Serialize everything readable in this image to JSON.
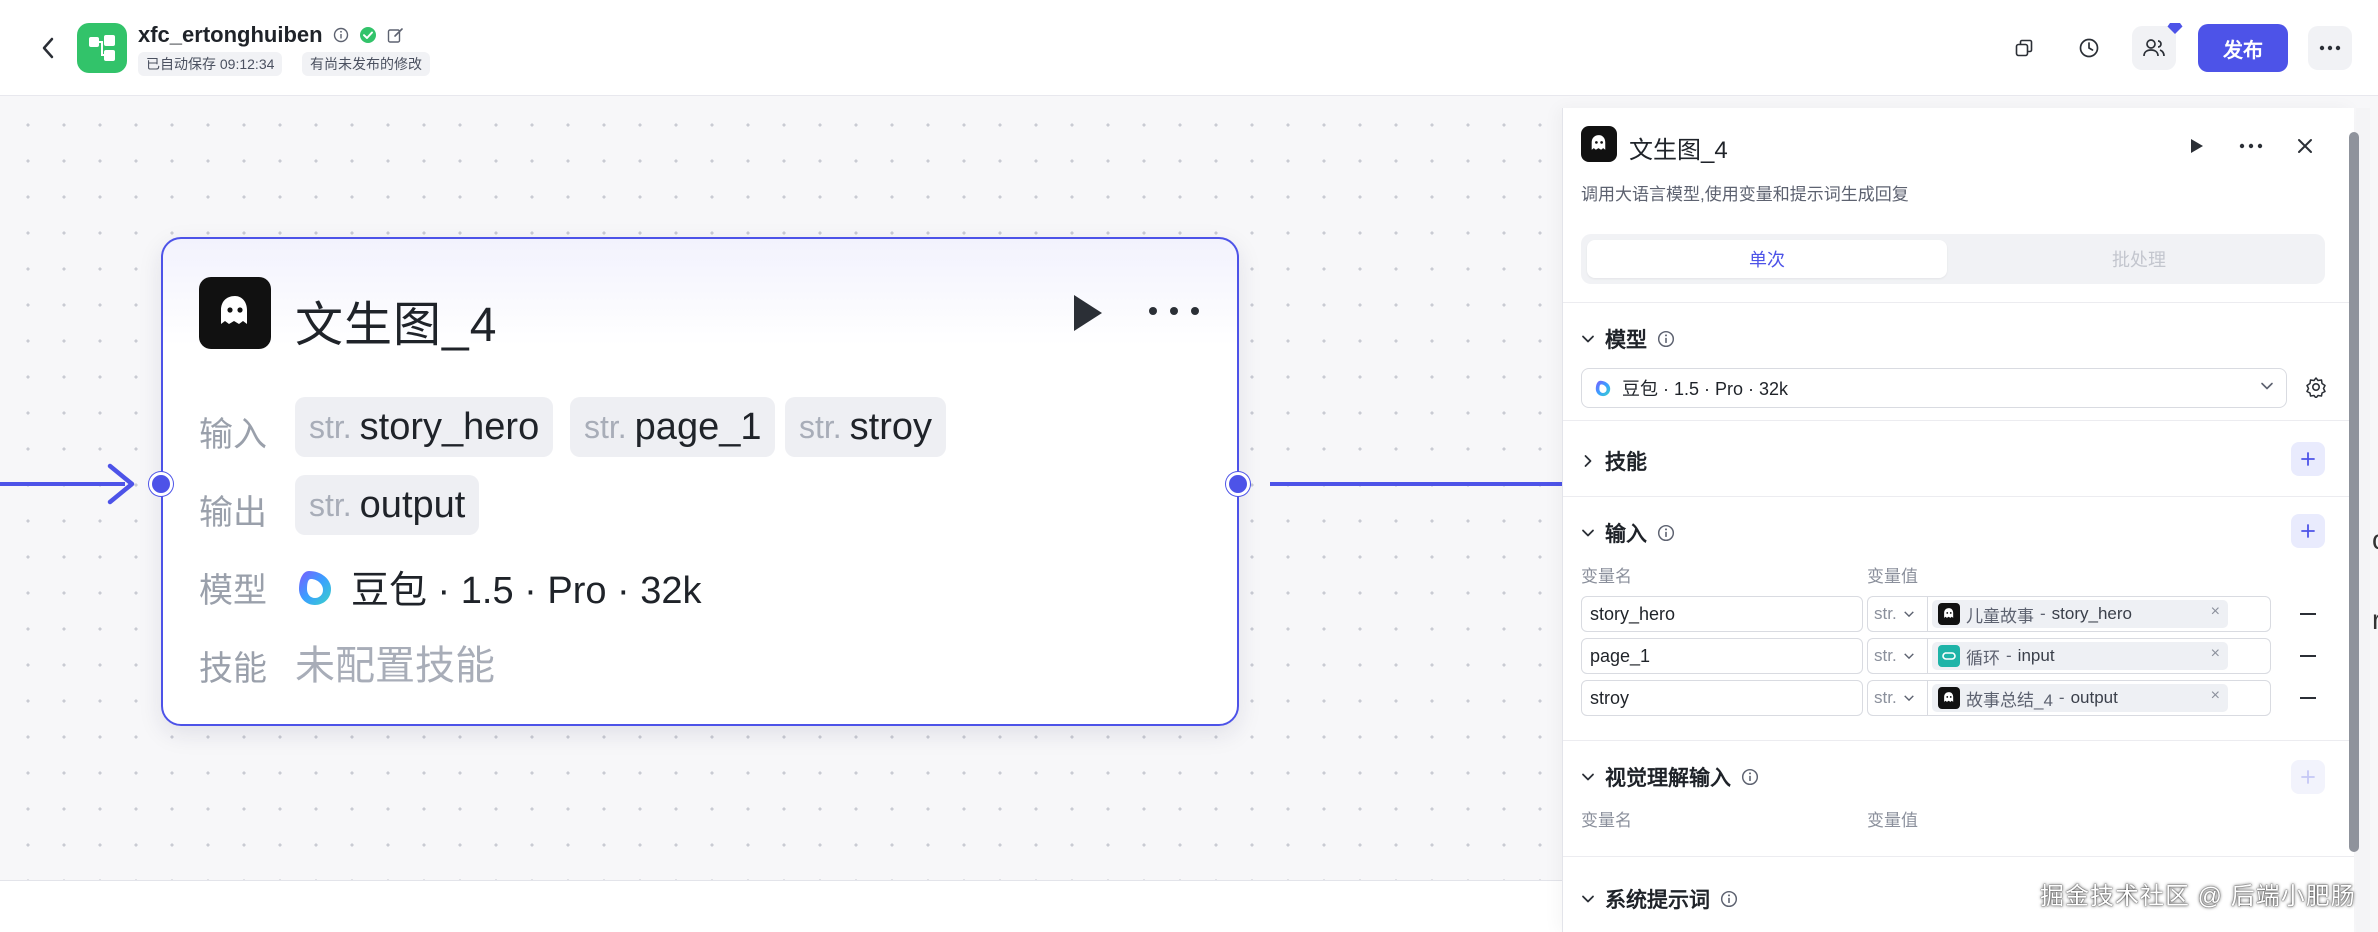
{
  "header": {
    "app_name": "xfc_ertonghuiben",
    "autosave_tag": "已自动保存 09:12:34",
    "unpublished_tag": "有尚未发布的修改",
    "publish_label": "发布"
  },
  "node": {
    "title": "文生图_4",
    "input_label": "输入",
    "output_label": "输出",
    "model_label": "模型",
    "skill_label": "技能",
    "inputs": [
      {
        "type": "str.",
        "name": "story_hero"
      },
      {
        "type": "str.",
        "name": "page_1"
      },
      {
        "type": "str.",
        "name": "stroy"
      }
    ],
    "output": {
      "type": "str.",
      "name": "output"
    },
    "model_value": "豆包 · 1.5 · Pro · 32k",
    "skill_value": "未配置技能"
  },
  "panel": {
    "title": "文生图_4",
    "description": "调用大语言模型,使用变量和提示词生成回复",
    "tabs": [
      {
        "label": "单次",
        "active": true
      },
      {
        "label": "批处理",
        "active": false
      }
    ],
    "model_section": "模型",
    "model_select": "豆包 · 1.5 · Pro · 32k",
    "skill_section": "技能",
    "input_section": "输入",
    "var_name_header": "变量名",
    "var_value_header": "变量值",
    "inputs": [
      {
        "name": "story_hero",
        "type": "str.",
        "source": "儿童故事",
        "sep": " - ",
        "ref": "story_hero",
        "icon": "ghost-icon"
      },
      {
        "name": "page_1",
        "type": "str.",
        "source": "循环",
        "sep": " - ",
        "ref": "input",
        "icon": "loop-icon"
      },
      {
        "name": "stroy",
        "type": "str.",
        "source": "故事总结_4",
        "sep": " - ",
        "ref": "output",
        "icon": "ghost-icon"
      }
    ],
    "vision_section": "视觉理解输入",
    "vision_var_name_header": "变量名",
    "vision_var_value_header": "变量值",
    "system_prompt_section": "系统提示词"
  },
  "edge_fragments": [
    "o",
    "r"
  ],
  "watermark": "掘金技术社区 @ 后端小肥肠",
  "colors": {
    "accent": "#4d53e8",
    "app_logo": "#32c36a",
    "verified": "#32c36a",
    "loop_icon": "#1fb4a8"
  }
}
